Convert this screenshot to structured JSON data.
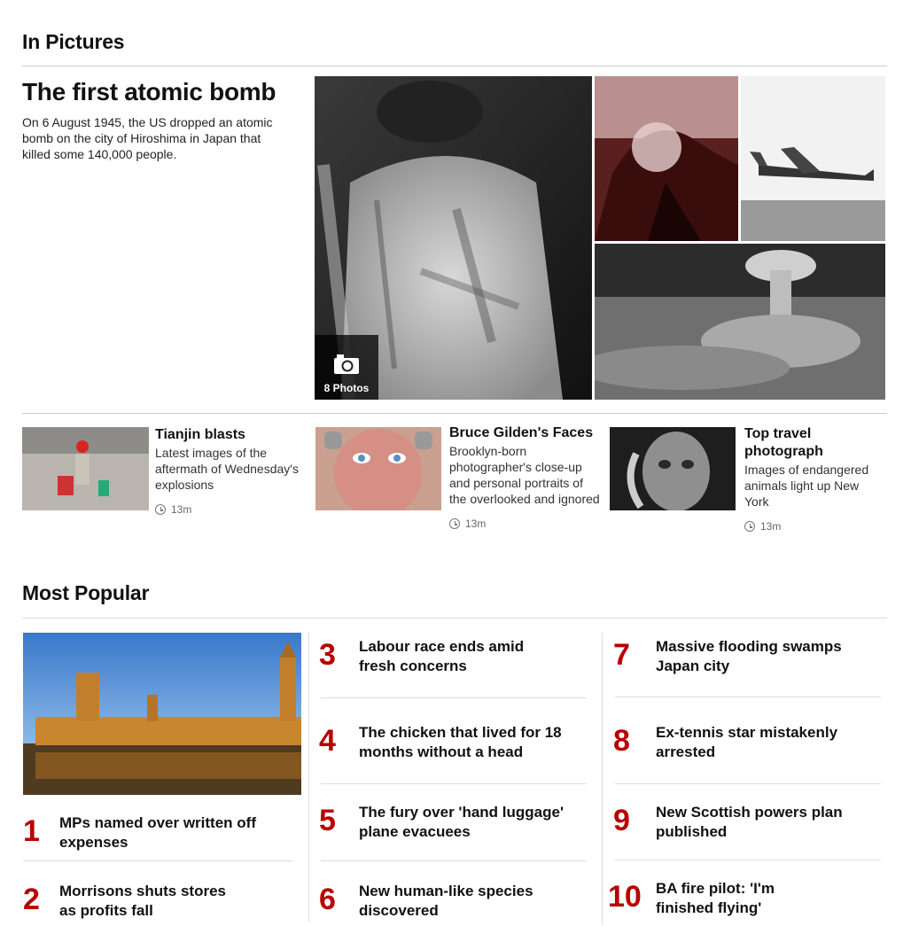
{
  "in_pictures": {
    "heading": "In Pictures",
    "hero": {
      "title": "The first atomic bomb",
      "description": "On 6 August 1945, the US dropped an atomic bomb on the city of Hiroshima in Japan that killed some 140,000 people.",
      "photo_count_label": "8 Photos"
    },
    "stories": [
      {
        "title": "Tianjin blasts",
        "summary": "Latest images of the aftermath of Wednesday's explosions",
        "time": "13m"
      },
      {
        "title": "Bruce Gilden's Faces",
        "summary": "Brooklyn-born photographer's close-up and personal portraits of the overlooked and ignored",
        "time": "13m"
      },
      {
        "title": "Top travel photograph",
        "summary": "Images of endangered animals light up New York",
        "time": "13m"
      }
    ]
  },
  "most_popular": {
    "heading": "Most Popular",
    "items": [
      {
        "rank": "1",
        "title": "MPs named over written off expenses"
      },
      {
        "rank": "2",
        "title": "Morrisons shuts stores as profits fall"
      },
      {
        "rank": "3",
        "title": "Labour race ends amid fresh concerns"
      },
      {
        "rank": "4",
        "title": "The chicken that lived for 18 months without a head"
      },
      {
        "rank": "5",
        "title": "The fury over 'hand luggage' plane evacuees"
      },
      {
        "rank": "6",
        "title": "New human-like species discovered"
      },
      {
        "rank": "7",
        "title": "Massive flooding swamps Japan city"
      },
      {
        "rank": "8",
        "title": "Ex-tennis star mistakenly arrested"
      },
      {
        "rank": "9",
        "title": "New Scottish powers plan published"
      },
      {
        "rank": "10",
        "title": "BA fire pilot: 'I'm finished flying'"
      }
    ]
  },
  "colors": {
    "accent_red": "#b80000",
    "rule_grey": "#cccccc"
  }
}
